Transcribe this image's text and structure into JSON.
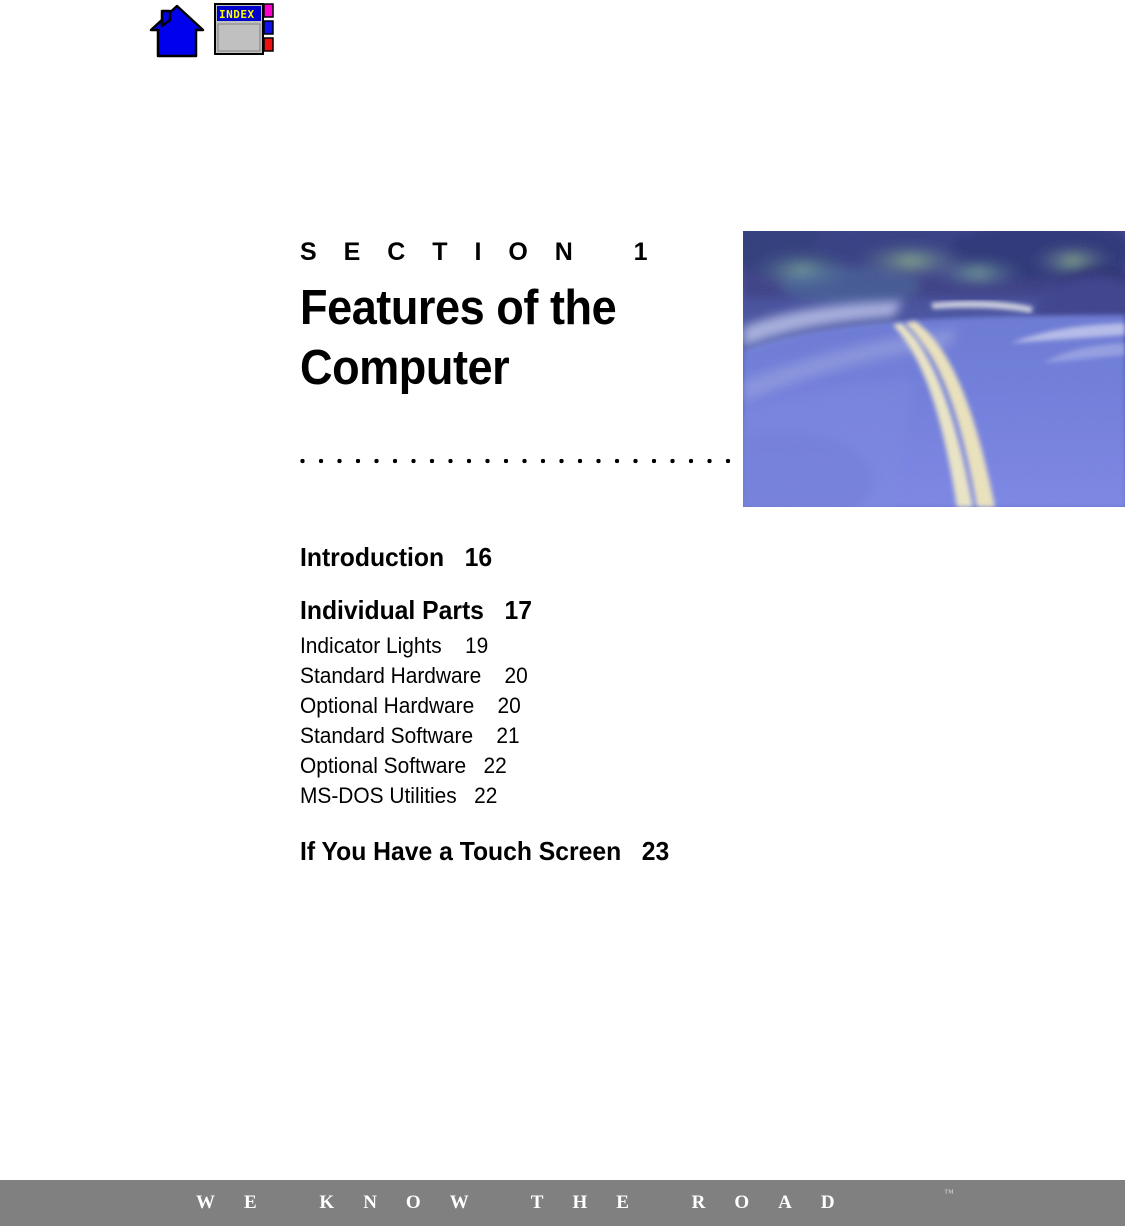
{
  "nav": {
    "home_icon": "home-icon",
    "index_icon": "index-icon",
    "index_label": "INDEX"
  },
  "section": {
    "eyebrow": "S E C T I O N   1",
    "title_line1": "Features of the",
    "title_line2": "Computer",
    "divider": "dotted-rule"
  },
  "photo": {
    "alt": "blurred blue-tinted photo of a curving road with double center lines and trees"
  },
  "toc": {
    "entries": [
      {
        "label": "Introduction",
        "page": "16",
        "level": "major"
      },
      {
        "label": "Individual Parts",
        "page": "17",
        "level": "major"
      },
      {
        "label": "Indicator Lights",
        "page": "19",
        "level": "minor"
      },
      {
        "label": "Standard Hardware",
        "page": "20",
        "level": "minor"
      },
      {
        "label": "Optional Hardware",
        "page": "20",
        "level": "minor"
      },
      {
        "label": "Standard Software",
        "page": "21",
        "level": "minor"
      },
      {
        "label": "Optional Software",
        "page": "22",
        "level": "minor"
      },
      {
        "label": "MS-DOS Utilities",
        "page": "22",
        "level": "minor"
      },
      {
        "label": "If You Have a Touch Screen",
        "page": "23",
        "level": "major"
      }
    ],
    "lines": {
      "introduction": "Introduction   16",
      "individual_parts": "Individual Parts   17",
      "indicator_lights": "Indicator Lights    19",
      "standard_hardware": "Standard Hardware    20",
      "optional_hardware": "Optional Hardware    20",
      "standard_software": "Standard Software    21",
      "optional_software": "Optional Software   22",
      "msdos_utilities": "MS-DOS Utilities   22",
      "touch_screen": "If You Have a Touch Screen   23"
    }
  },
  "footer": {
    "tagline": "WE KNOW THE ROAD",
    "trademark": "™"
  },
  "colors": {
    "home_icon_blue": "#0000ee",
    "index_titlebar_blue": "#0000cc",
    "index_label_yellow": "#ffff00",
    "index_body_gray": "#c0c0c0",
    "tab_magenta": "#ff00cc",
    "tab_blue": "#1111ee",
    "tab_red": "#ee1111",
    "footer_gray": "#808080",
    "footer_text": "#ffffff",
    "photo_blue": "#5560d8",
    "text_black": "#000000"
  }
}
